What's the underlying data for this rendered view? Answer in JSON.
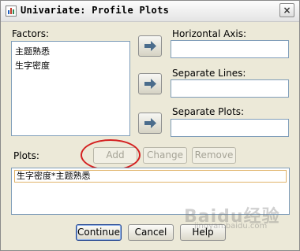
{
  "window": {
    "title": "Univariate: Profile Plots",
    "close_glyph": "×"
  },
  "factors": {
    "label": "Factors:",
    "items": [
      "主题熟悉",
      "生字密度"
    ]
  },
  "targets": {
    "horizontal_axis": {
      "label": "Horizontal Axis:",
      "value": ""
    },
    "separate_lines": {
      "label": "Separate Lines:",
      "value": ""
    },
    "separate_plots": {
      "label": "Separate Plots:",
      "value": ""
    }
  },
  "plots": {
    "label": "Plots:",
    "add": "Add",
    "change": "Change",
    "remove": "Remove",
    "items": [
      "生字密度*主题熟悉"
    ]
  },
  "footer": {
    "continue": "Continue",
    "cancel": "Cancel",
    "help": "Help"
  },
  "watermark": {
    "logo": "Baidu经验",
    "url": "jingyan.baidu.com"
  },
  "colors": {
    "annotation": "#d42020",
    "default_border": "#1c3f8e"
  }
}
